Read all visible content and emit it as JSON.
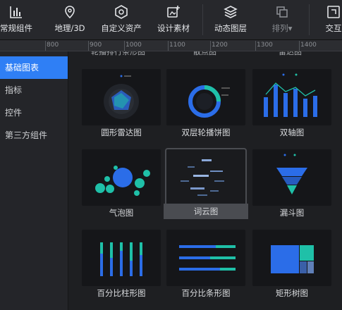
{
  "toolbar": {
    "items": [
      {
        "label": "常规组件",
        "icon": "bar-chart-icon"
      },
      {
        "label": "地理/3D",
        "icon": "map-pin-icon"
      },
      {
        "label": "自定义资产",
        "icon": "hexagon-icon"
      },
      {
        "label": "设计素材",
        "icon": "image-plus-icon"
      },
      {
        "label": "动态图层",
        "icon": "layers-icon"
      },
      {
        "label": "排列▾",
        "icon": "arrange-icon"
      },
      {
        "label": "交互",
        "icon": "interaction-icon"
      }
    ]
  },
  "ruler": {
    "marks": [
      "800",
      "900",
      "1000",
      "1100",
      "1200",
      "1300",
      "1400"
    ]
  },
  "sidebar": {
    "items": [
      {
        "label": "基础图表",
        "active": true
      },
      {
        "label": "指标",
        "active": false
      },
      {
        "label": "控件",
        "active": false
      },
      {
        "label": "第三方组件",
        "active": false
      }
    ]
  },
  "grid": {
    "top_partial_labels": [
      "轮播排行条形图",
      "散点图",
      "雷达图"
    ],
    "cards": [
      {
        "label": "圆形雷达图",
        "icon": "radar-chart-icon"
      },
      {
        "label": "双层轮播饼图",
        "icon": "ring-pie-chart-icon"
      },
      {
        "label": "双轴图",
        "icon": "dual-axis-chart-icon"
      },
      {
        "label": "气泡图",
        "icon": "bubble-chart-icon"
      },
      {
        "label": "词云图",
        "icon": "word-cloud-icon",
        "selected": true
      },
      {
        "label": "漏斗图",
        "icon": "funnel-chart-icon"
      },
      {
        "label": "百分比柱形图",
        "icon": "percent-column-chart-icon"
      },
      {
        "label": "百分比条形图",
        "icon": "percent-bar-chart-icon"
      },
      {
        "label": "矩形树图",
        "icon": "treemap-icon"
      }
    ]
  },
  "colors": {
    "accent": "#2f7ff5",
    "teal": "#1fc0a8",
    "blue": "#2b6de8"
  }
}
